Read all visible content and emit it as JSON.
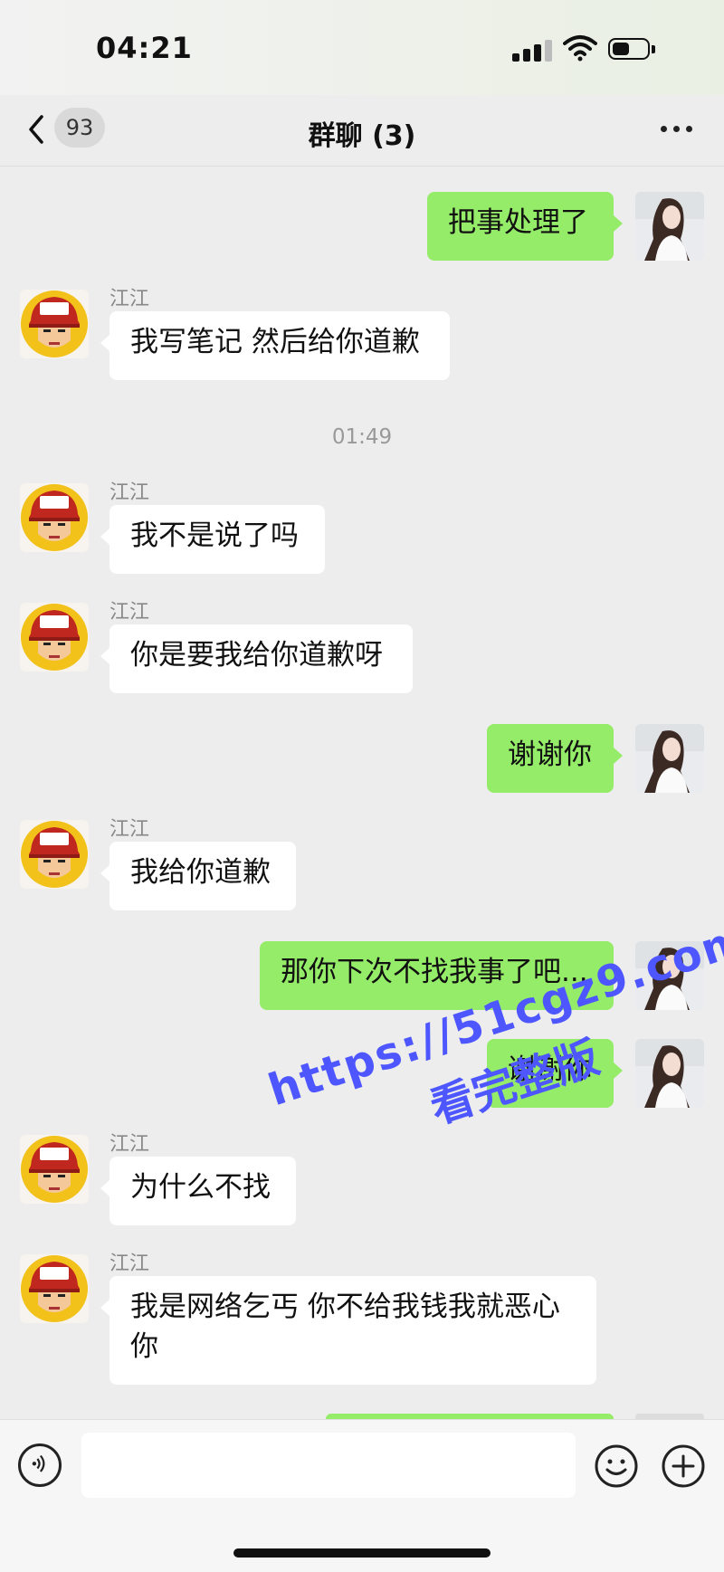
{
  "status_bar": {
    "time": "04:21"
  },
  "nav": {
    "back_count": "93",
    "title": "群聊 (3)"
  },
  "colors": {
    "sent_bubble": "#95ec69",
    "received_bubble": "#ffffff",
    "background": "#ededed",
    "watermark": "#4e57ff"
  },
  "messages": [
    {
      "side": "right",
      "text": "把事处理了"
    },
    {
      "side": "left",
      "sender": "江江",
      "text": "我写笔记 然后给你道歉"
    },
    {
      "type": "timestamp",
      "text": "01:49"
    },
    {
      "side": "left",
      "sender": "江江",
      "text": "我不是说了吗"
    },
    {
      "side": "left",
      "sender": "江江",
      "text": "你是要我给你道歉呀"
    },
    {
      "side": "right",
      "text": "谢谢你"
    },
    {
      "side": "left",
      "sender": "江江",
      "text": "我给你道歉"
    },
    {
      "side": "right",
      "text": "那你下次不找我事了吧..."
    },
    {
      "side": "right",
      "text": "谢谢你"
    },
    {
      "side": "left",
      "sender": "江江",
      "text": "为什么不找"
    },
    {
      "side": "left",
      "sender": "江江",
      "text": "我是网络乞丐 你不给我钱我就恶心你"
    }
  ],
  "avatar_badge_text": "江江",
  "watermark": {
    "line1": "https://51cgz9.com",
    "line2": "看完整版"
  },
  "input_bar": {
    "voice_icon": "voice-icon",
    "emoji_icon": "emoji-icon",
    "plus_icon": "plus-icon"
  }
}
